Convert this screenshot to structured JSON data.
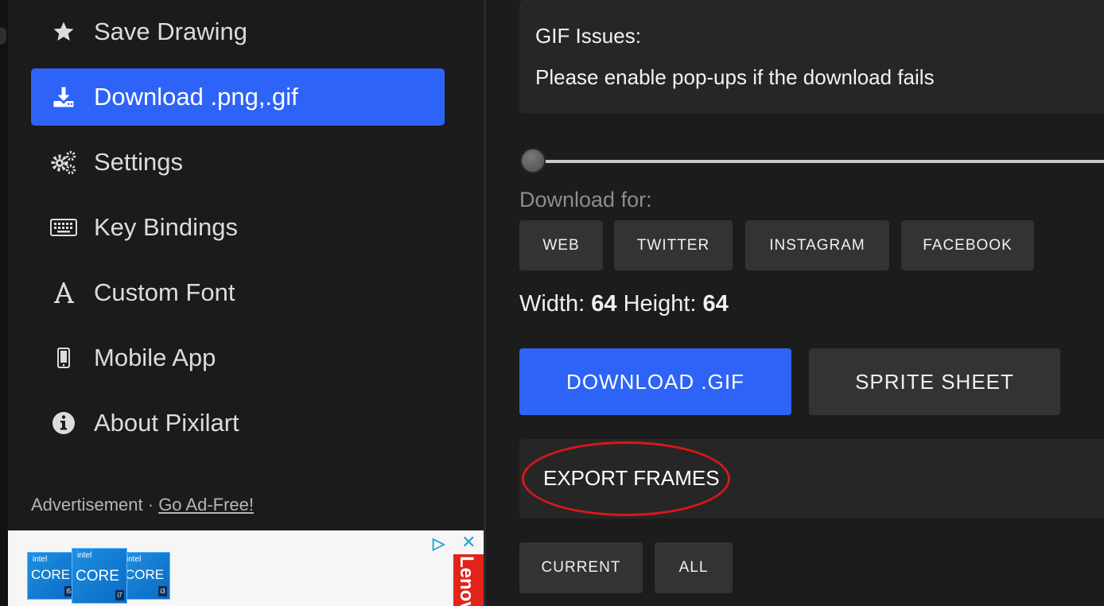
{
  "sidebar": {
    "items": [
      {
        "label": "Save Drawing",
        "icon": "star-icon"
      },
      {
        "label": "Download .png,.gif",
        "icon": "download-icon",
        "active": true
      },
      {
        "label": "Settings",
        "icon": "gears-icon"
      },
      {
        "label": "Key Bindings",
        "icon": "keyboard-icon"
      },
      {
        "label": "Custom Font",
        "icon": "font-icon"
      },
      {
        "label": "Mobile App",
        "icon": "mobile-icon"
      },
      {
        "label": "About Pixilart",
        "icon": "info-icon"
      }
    ],
    "ad": {
      "label": "Advertisement",
      "separator": " · ",
      "go_ad_free": "Go Ad-Free!",
      "chips": [
        {
          "brand": "intel",
          "core": "CORE",
          "gen": "i5"
        },
        {
          "brand": "intel",
          "core": "CORE",
          "gen": "i7"
        },
        {
          "brand": "intel",
          "core": "CORE",
          "gen": "i3"
        }
      ],
      "lenovo": "Lenovo"
    }
  },
  "panel": {
    "gif_issues_title": "GIF Issues:",
    "gif_issues_note": "Please enable pop-ups if the download fails",
    "scale_slider": {
      "value": 0
    },
    "download_for_label": "Download for:",
    "platforms": [
      "WEB",
      "TWITTER",
      "INSTAGRAM",
      "FACEBOOK"
    ],
    "width_label": "Width:",
    "width_value": "64",
    "height_label": "Height:",
    "height_value": "64",
    "download_gif": "DOWNLOAD .GIF",
    "sprite_sheet": "SPRITE SHEET",
    "export_frames": "EXPORT FRAMES",
    "frame_options": [
      "CURRENT",
      "ALL"
    ]
  },
  "colors": {
    "accent": "#2d63f7",
    "background": "#1c1c1c",
    "button": "#333333",
    "annotation": "#d81818"
  }
}
